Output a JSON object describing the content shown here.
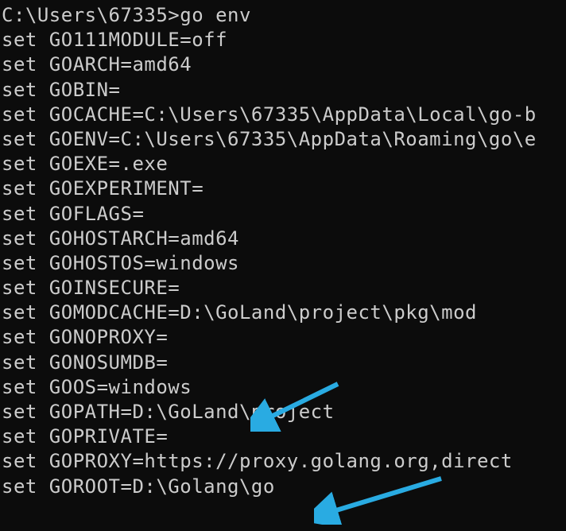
{
  "prompt": {
    "path": "C:\\Users\\67335>",
    "command": "go env"
  },
  "lines": [
    "set GO111MODULE=off",
    "set GOARCH=amd64",
    "set GOBIN=",
    "set GOCACHE=C:\\Users\\67335\\AppData\\Local\\go-b",
    "set GOENV=C:\\Users\\67335\\AppData\\Roaming\\go\\e",
    "set GOEXE=.exe",
    "set GOEXPERIMENT=",
    "set GOFLAGS=",
    "set GOHOSTARCH=amd64",
    "set GOHOSTOS=windows",
    "set GOINSECURE=",
    "set GOMODCACHE=D:\\GoLand\\project\\pkg\\mod",
    "set GONOPROXY=",
    "set GONOSUMDB=",
    "set GOOS=windows",
    "set GOPATH=D:\\GoLand\\project",
    "set GOPRIVATE=",
    "set GOPROXY=https://proxy.golang.org,direct",
    "set GOROOT=D:\\Golang\\go"
  ],
  "annotations": {
    "arrow_color": "#29abe2"
  }
}
